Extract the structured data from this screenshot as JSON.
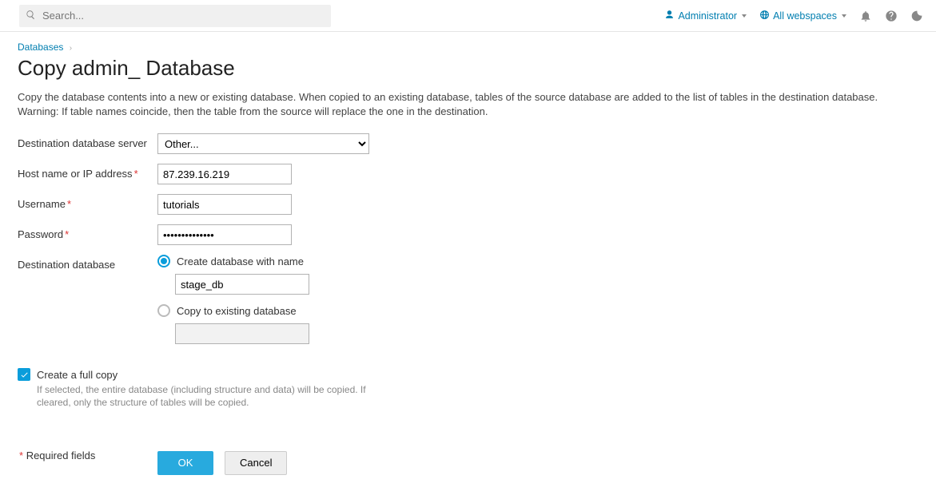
{
  "topbar": {
    "search_placeholder": "Search...",
    "user_label": "Administrator",
    "webspaces_label": "All webspaces"
  },
  "breadcrumb": {
    "parent": "Databases"
  },
  "page_title": "Copy admin_ Database",
  "description": "Copy the database contents into a new or existing database. When copied to an existing database, tables of the source database are added to the list of tables in the destination database. Warning: If table names coincide, then the table from the source will replace the one in the destination.",
  "form": {
    "dest_server_label": "Destination database server",
    "dest_server_value": "Other...",
    "host_label": "Host name or IP address",
    "host_value": "87.239.16.219",
    "username_label": "Username",
    "username_value": "tutorials",
    "password_label": "Password",
    "password_value": "••••••••••••••",
    "dest_db_label": "Destination database",
    "radio_create_label": "Create database with name",
    "create_db_value": "stage_db",
    "radio_existing_label": "Copy to existing database",
    "existing_db_value": "",
    "fullcopy_label": "Create a full copy",
    "fullcopy_hint": "If selected, the entire database (including structure and data) will be copied. If cleared, only the structure of tables will be copied.",
    "required_note": "Required fields"
  },
  "buttons": {
    "ok": "OK",
    "cancel": "Cancel"
  }
}
